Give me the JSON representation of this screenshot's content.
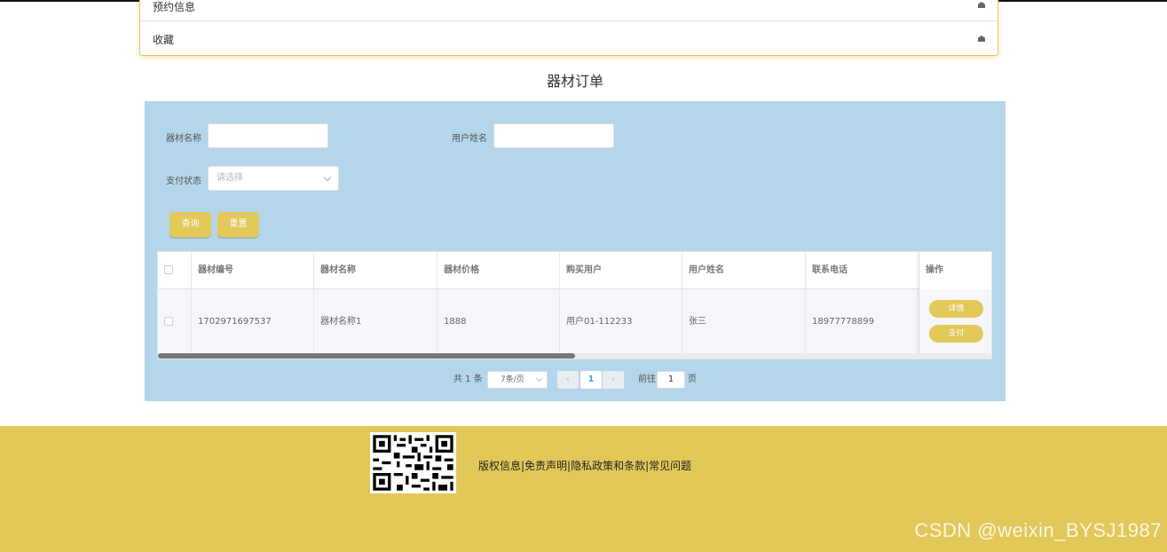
{
  "menu": {
    "items": [
      {
        "label": "预约信息",
        "icon": "home-icon"
      },
      {
        "label": "收藏",
        "icon": "home-icon"
      }
    ]
  },
  "page": {
    "title": "器材订单"
  },
  "search": {
    "name_label": "器材名称",
    "user_label": "用户姓名",
    "status_label": "支付状态",
    "status_placeholder": "请选择",
    "query_label": "查询",
    "reset_label": "重置"
  },
  "table": {
    "columns": [
      "器材编号",
      "器材名称",
      "器材价格",
      "购买用户",
      "用户姓名",
      "联系电话",
      "操作"
    ],
    "rows": [
      {
        "code": "1702971697537",
        "name": "器材名称1",
        "price": "1888",
        "buyer": "用户01-112233",
        "username": "张三",
        "phone": "18977778899"
      }
    ],
    "detail_label": "详情",
    "pay_label": "支付"
  },
  "pagination": {
    "total_text": "共 1 条",
    "page_size": "7条/页",
    "current_page": "1",
    "goto_label": "前往",
    "goto_value": "1",
    "page_suffix": "页"
  },
  "footer": {
    "links": "版权信息|免责声明|隐私政策和条款|常见问题",
    "watermark": "CSDN @weixin_BYSJ1987"
  },
  "colors": {
    "accent": "#e3c85a",
    "panel": "#b3d6ea",
    "footer": "#e2c858"
  }
}
